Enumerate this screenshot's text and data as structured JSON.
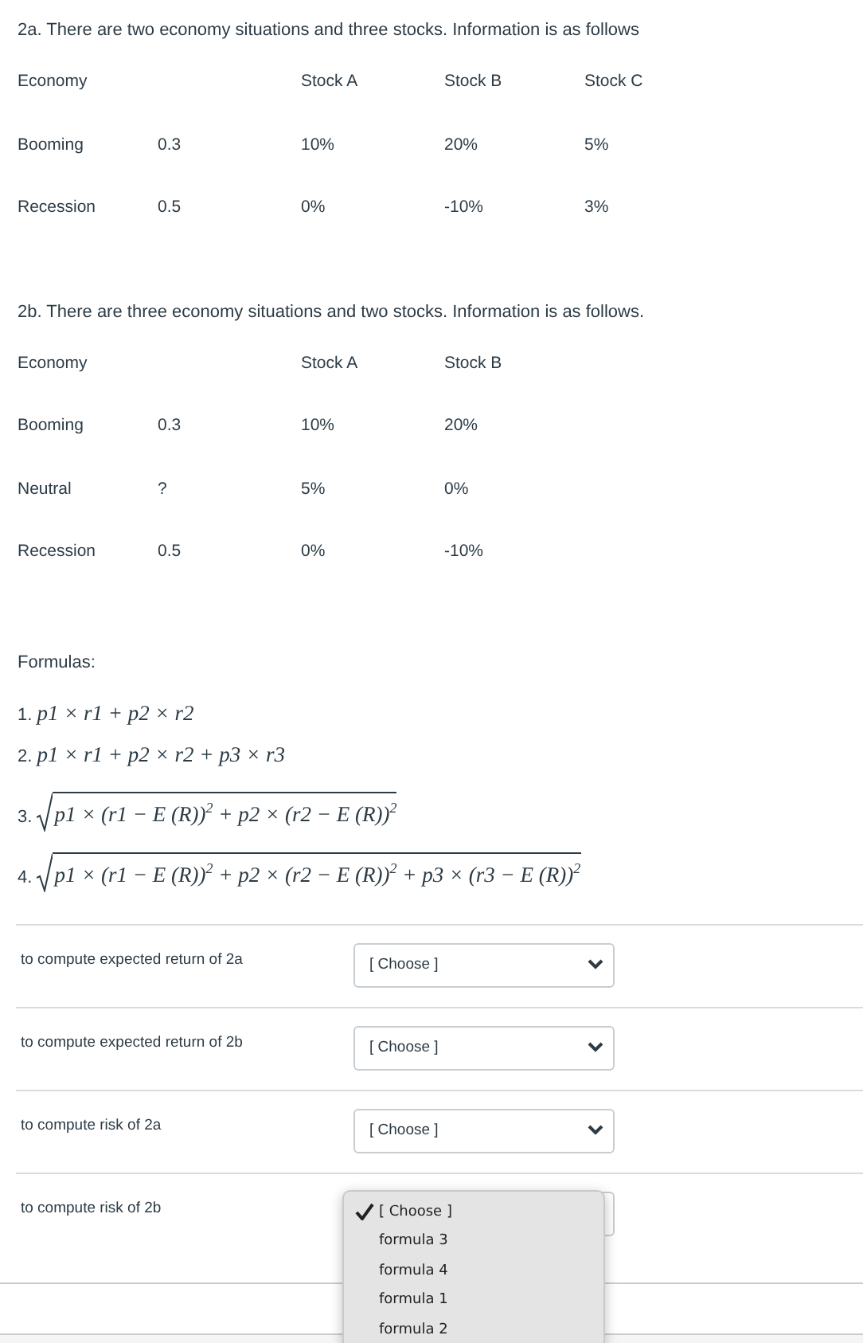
{
  "sections": [
    {
      "intro": "2a. There are two economy situations and three stocks. Information is as follows",
      "table": {
        "header": [
          "Economy",
          "Stock A",
          "Stock B",
          "Stock C"
        ],
        "rows": [
          {
            "economy": "Booming",
            "probability": "0.3",
            "returns": [
              "10%",
              "20%",
              "5%"
            ]
          },
          {
            "economy": "Recession",
            "probability": "0.5",
            "returns": [
              "0%",
              "-10%",
              "3%"
            ]
          }
        ]
      }
    },
    {
      "intro": "2b. There are three economy situations and two stocks. Information is as follows.",
      "table": {
        "header": [
          "Economy",
          "Stock A",
          "Stock B"
        ],
        "rows": [
          {
            "economy": "Booming",
            "probability": "0.3",
            "returns": [
              "10%",
              "20%"
            ]
          },
          {
            "economy": "Neutral",
            "probability": "?",
            "returns": [
              "5%",
              "0%"
            ]
          },
          {
            "economy": "Recession",
            "probability": "0.5",
            "returns": [
              "0%",
              "-10%"
            ]
          }
        ]
      }
    }
  ],
  "formulas": {
    "title": "Formulas:",
    "items": [
      {
        "number": "1.",
        "sqrt": false,
        "expr": "p1 × r1 + p2 × r2"
      },
      {
        "number": "2.",
        "sqrt": false,
        "expr": "p1 × r1 + p2 × r2 + p3 × r3"
      },
      {
        "number": "3.",
        "sqrt": true,
        "expr": "p1 × (r1 − E (R))$^{2}$ + p2 × (r2 − E (R))$^{2}$"
      },
      {
        "number": "4.",
        "sqrt": true,
        "expr": "p1 × (r1 − E (R))$^{2}$ + p2 × (r2 − E (R))$^{2}$ + p3 × (r3 − E (R))$^{2}$"
      }
    ]
  },
  "questions": [
    {
      "label": "to compute expected return of 2a",
      "value": "[ Choose ]"
    },
    {
      "label": "to compute expected return of 2b",
      "value": "[ Choose ]"
    },
    {
      "label": "to compute risk of 2a",
      "value": "[ Choose ]"
    },
    {
      "label": "to compute risk of 2b",
      "menu": {
        "options": [
          {
            "label": "[ Choose ]",
            "selected": true
          },
          {
            "label": "formula 3",
            "selected": false
          },
          {
            "label": "formula 4",
            "selected": false
          },
          {
            "label": "formula 1",
            "selected": false
          },
          {
            "label": "formula 2",
            "selected": false
          }
        ]
      }
    }
  ]
}
